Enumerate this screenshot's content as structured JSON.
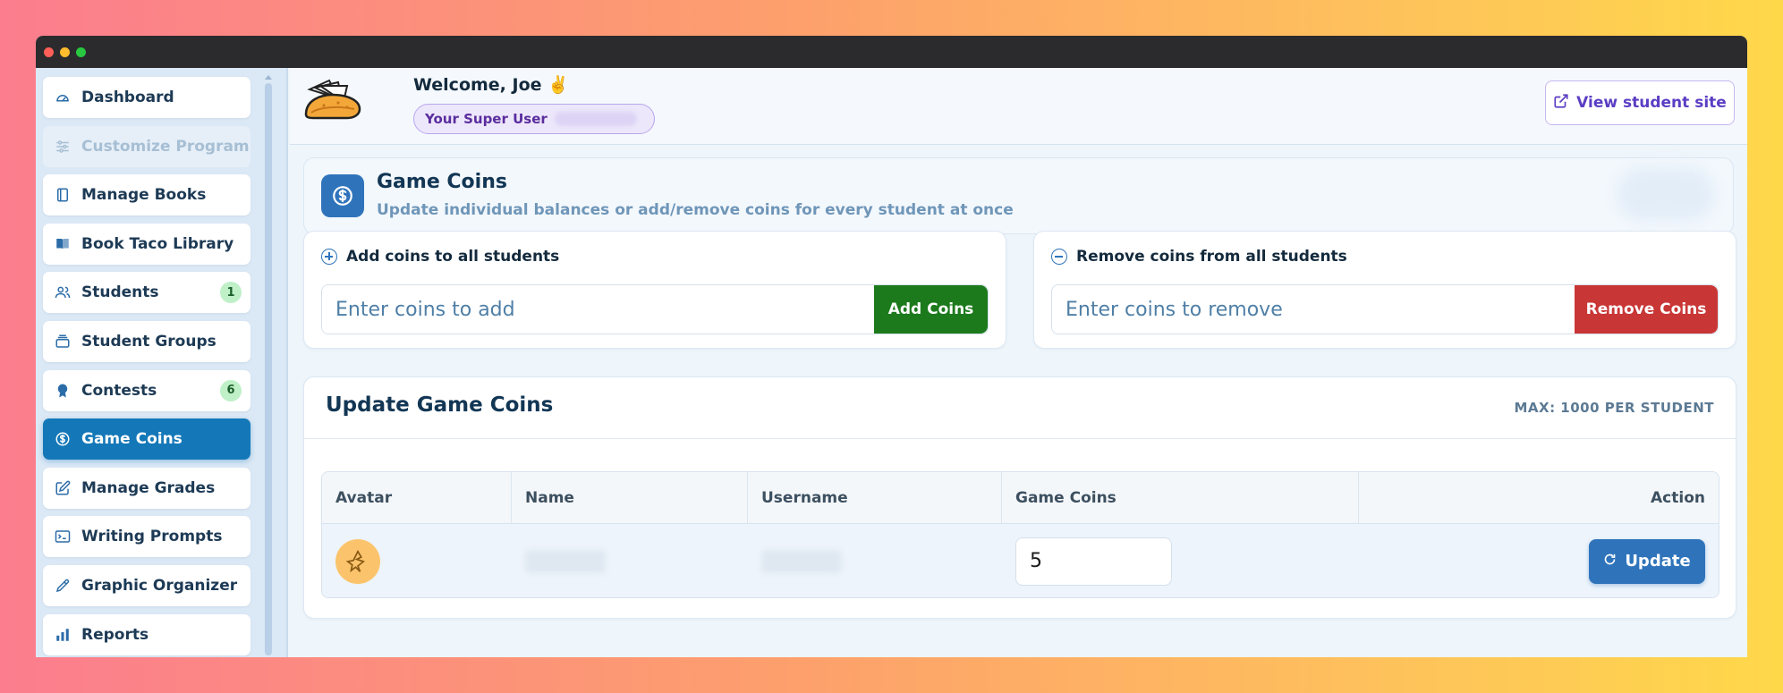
{
  "sidebar": {
    "items": [
      {
        "label": "Dashboard",
        "icon": "gauge-icon",
        "state": "normal",
        "badge": ""
      },
      {
        "label": "Customize Program",
        "icon": "sliders-icon",
        "state": "disabled",
        "badge": ""
      },
      {
        "label": "Manage Books",
        "icon": "notebook-icon",
        "state": "normal",
        "badge": ""
      },
      {
        "label": "Book Taco Library",
        "icon": "open-book-icon",
        "state": "normal",
        "badge": ""
      },
      {
        "label": "Students",
        "icon": "users-icon",
        "state": "normal",
        "badge": "1"
      },
      {
        "label": "Student Groups",
        "icon": "layers-icon",
        "state": "normal",
        "badge": ""
      },
      {
        "label": "Contests",
        "icon": "medal-icon",
        "state": "normal",
        "badge": "6"
      },
      {
        "label": "Game Coins",
        "icon": "dollar-coin-icon",
        "state": "active",
        "badge": ""
      },
      {
        "label": "Manage Grades",
        "icon": "edit-icon",
        "state": "normal",
        "badge": ""
      },
      {
        "label": "Writing Prompts",
        "icon": "terminal-icon",
        "state": "normal",
        "badge": ""
      },
      {
        "label": "Graphic Organizer",
        "icon": "pen-icon",
        "state": "normal",
        "badge": ""
      },
      {
        "label": "Reports",
        "icon": "bar-chart-icon",
        "state": "normal",
        "badge": ""
      }
    ]
  },
  "header": {
    "welcome": "Welcome, Joe ✌️",
    "role": "Your Super User",
    "view_site": "View student site"
  },
  "hero": {
    "title": "Game Coins",
    "subtitle": "Update individual balances or add/remove coins for every student at once"
  },
  "add_card": {
    "title": "Add coins to all students",
    "placeholder": "Enter coins to add",
    "button": "Add Coins"
  },
  "remove_card": {
    "title": "Remove coins from all students",
    "placeholder": "Enter coins to remove",
    "button": "Remove Coins"
  },
  "table_card": {
    "title": "Update Game Coins",
    "max_note": "MAX: 1000 PER STUDENT",
    "columns": [
      "Avatar",
      "Name",
      "Username",
      "Game Coins",
      "Action"
    ],
    "rows": [
      {
        "game_coins": "5",
        "action": "Update"
      }
    ]
  },
  "colors": {
    "accent": "#1478b8",
    "add": "#1c7a1c",
    "remove": "#c93636",
    "update": "#2f74bb"
  }
}
